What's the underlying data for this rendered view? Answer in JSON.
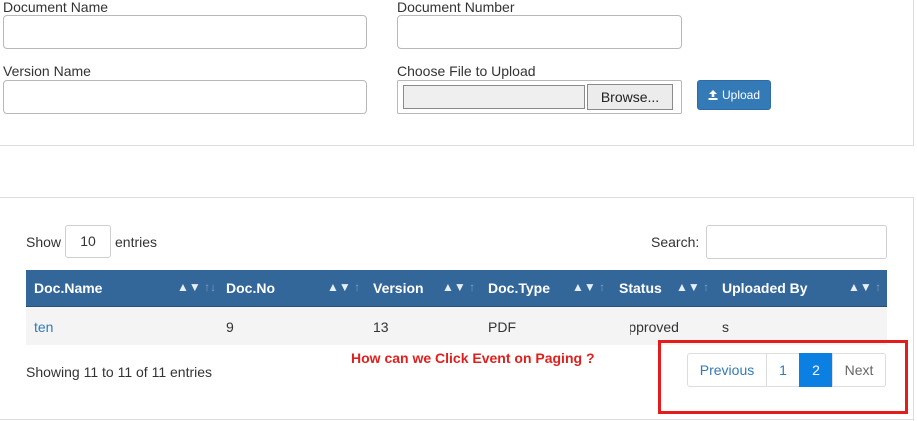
{
  "form": {
    "document_name_label": "Document Name",
    "document_number_label": "Document Number",
    "version_name_label": "Version Name",
    "choose_file_label": "Choose File to Upload",
    "browse_label": "Browse...",
    "upload_label": "Upload",
    "document_name_value": "",
    "document_number_value": "",
    "version_name_value": ""
  },
  "table_controls": {
    "show_label": "Show",
    "page_length": "10",
    "entries_label": "entries",
    "search_label": "Search:",
    "search_value": ""
  },
  "table": {
    "columns": [
      "Doc.Name",
      "Doc.No",
      "Version",
      "Doc.Type",
      "Status",
      "Uploaded By"
    ],
    "rows": [
      {
        "doc_name": "ten",
        "doc_no": "9",
        "version": "13",
        "doc_type": "PDF",
        "status": "Approved",
        "uploaded_by": "s"
      }
    ]
  },
  "info": "Showing 11 to 11 of 11 entries",
  "annotation": "How can we Click Event on Paging ?",
  "pagination": {
    "previous": "Previous",
    "pages": [
      "1",
      "2"
    ],
    "active_page": "2",
    "next": "Next"
  },
  "colors": {
    "header_bg": "#336699",
    "accent": "#337ab7",
    "active_page": "#0b80e2",
    "annotation": "#e0201e"
  },
  "icons": {
    "upload": "upload-icon",
    "sort": "sort-arrows-icon"
  }
}
